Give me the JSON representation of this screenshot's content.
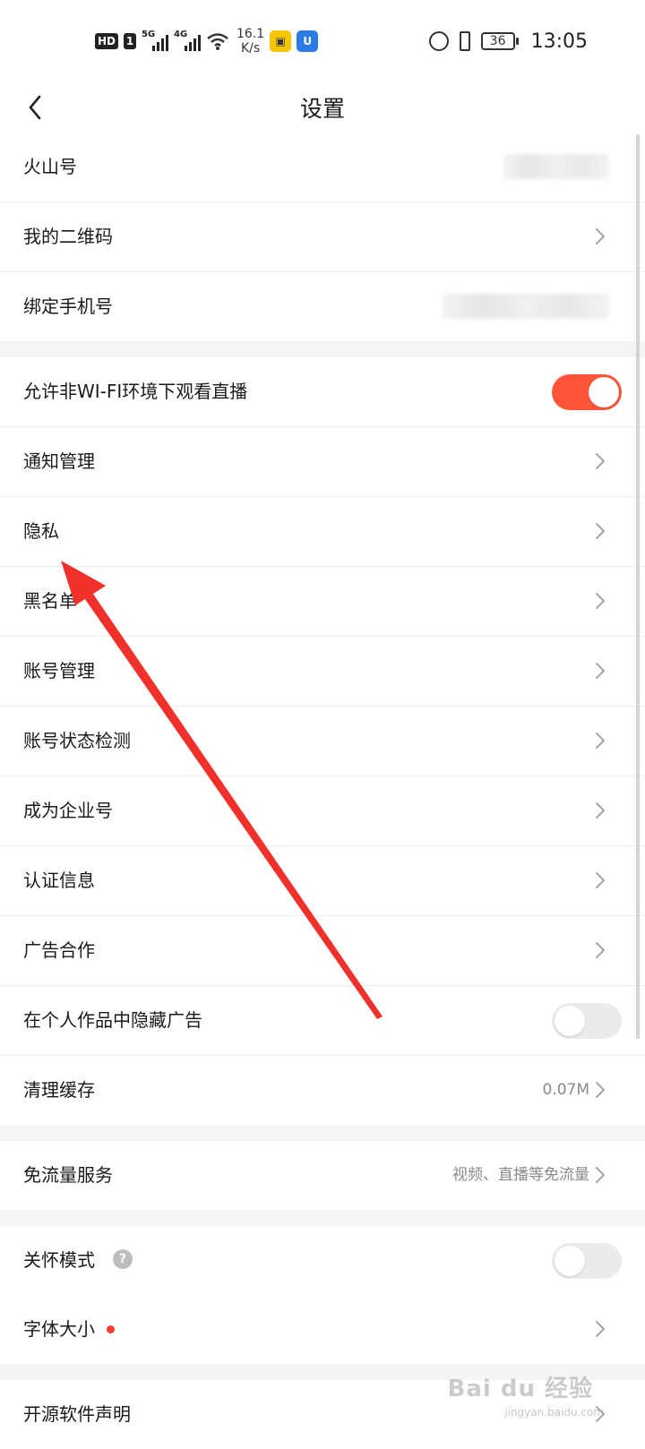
{
  "status_bar": {
    "hd": "HD",
    "sim": "1",
    "net1": "5G",
    "net2": "4G",
    "speed_value": "16.1",
    "speed_unit": "K/s",
    "battery": "36",
    "time": "13:05"
  },
  "nav": {
    "title": "设置"
  },
  "section1": [
    {
      "label": "火山号",
      "value": "",
      "type": "blurred"
    },
    {
      "label": "我的二维码",
      "type": "chevron"
    },
    {
      "label": "绑定手机号",
      "value": "",
      "type": "blurred"
    }
  ],
  "section2": [
    {
      "label": "允许非WI-FI环境下观看直播",
      "type": "toggle",
      "on": true
    },
    {
      "label": "通知管理",
      "type": "chevron"
    },
    {
      "label": "隐私",
      "type": "chevron"
    },
    {
      "label": "黑名单",
      "type": "chevron"
    },
    {
      "label": "账号管理",
      "type": "chevron"
    },
    {
      "label": "账号状态检测",
      "type": "chevron"
    },
    {
      "label": "成为企业号",
      "type": "chevron"
    },
    {
      "label": "认证信息",
      "type": "chevron"
    },
    {
      "label": "广告合作",
      "type": "chevron"
    },
    {
      "label": "在个人作品中隐藏广告",
      "type": "toggle",
      "on": false
    },
    {
      "label": "清理缓存",
      "value": "0.07M",
      "type": "chevron"
    }
  ],
  "section3": [
    {
      "label": "免流量服务",
      "value": "视频、直播等免流量",
      "type": "chevron"
    }
  ],
  "section4": [
    {
      "label": "关怀模式",
      "type": "toggle",
      "on": false,
      "help": "?"
    },
    {
      "label": "字体大小",
      "type": "chevron",
      "dot": true
    }
  ],
  "section5": [
    {
      "label": "开源软件声明",
      "type": "chevron"
    }
  ],
  "watermark": {
    "main": "Bai du 经验",
    "sub": "jingyan.baidu.com"
  },
  "colors": {
    "accent": "#fe5438",
    "annotation_arrow": "#f0302a"
  }
}
